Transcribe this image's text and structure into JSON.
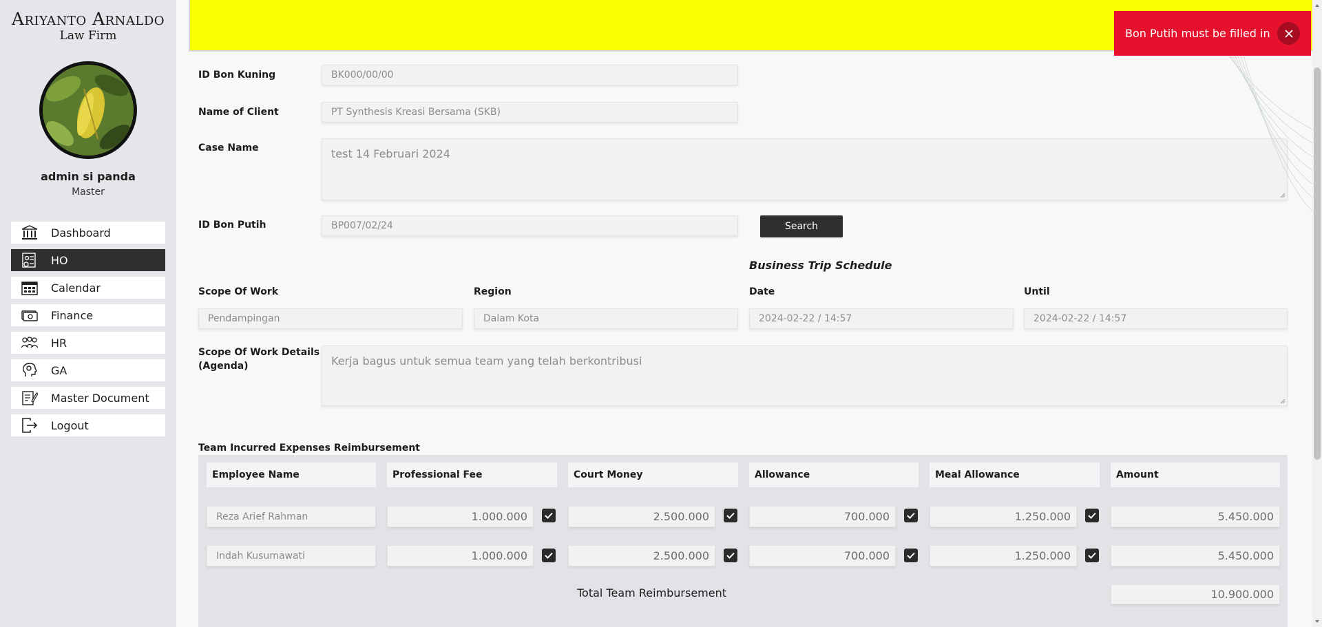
{
  "brand": {
    "line1": "Ariyanto Arnaldo",
    "line2": "Law Firm"
  },
  "user": {
    "name": "admin si panda",
    "role": "Master"
  },
  "nav": [
    {
      "label": "Dashboard",
      "icon": "bank-icon",
      "active": false
    },
    {
      "label": "HO",
      "icon": "document-id-icon",
      "active": true
    },
    {
      "label": "Calendar",
      "icon": "calendar-icon",
      "active": false
    },
    {
      "label": "Finance",
      "icon": "money-icon",
      "active": false
    },
    {
      "label": "HR",
      "icon": "people-icon",
      "active": false
    },
    {
      "label": "GA",
      "icon": "gear-head-icon",
      "active": false
    },
    {
      "label": "Master Document",
      "icon": "edit-document-icon",
      "active": false
    },
    {
      "label": "Logout",
      "icon": "logout-icon",
      "active": false
    }
  ],
  "form": {
    "id_bon_kuning": {
      "label": "ID Bon Kuning",
      "placeholder": "BK000/00/00"
    },
    "client": {
      "label": "Name of Client",
      "value": "PT Synthesis Kreasi Bersama (SKB)"
    },
    "case_name": {
      "label": "Case Name",
      "value": "test 14 Februari 2024"
    },
    "id_bon_putih": {
      "label": "ID Bon Putih",
      "value": "BP007/02/24"
    },
    "search_button": "Search",
    "schedule_title": "Business Trip Schedule",
    "scope": {
      "label": "Scope Of Work",
      "value": "Pendampingan"
    },
    "region": {
      "label": "Region",
      "value": "Dalam Kota"
    },
    "date": {
      "label": "Date",
      "value": "2024-02-22 / 14:57"
    },
    "until": {
      "label": "Until",
      "value": "2024-02-22 / 14:57"
    },
    "scope_details": {
      "label_line1": "Scope Of Work Details",
      "label_line2": "(Agenda)",
      "value": "Kerja bagus untuk semua team yang telah berkontribusi"
    }
  },
  "reimbursement": {
    "title": "Team Incurred Expenses Reimbursement",
    "columns": [
      "Employee Name",
      "Professional Fee",
      "Court Money",
      "Allowance",
      "Meal Allowance",
      "Amount"
    ],
    "rows": [
      {
        "name": "Reza Arief Rahman",
        "professional_fee": "1.000.000",
        "court_money": "2.500.000",
        "allowance": "700.000",
        "meal_allowance": "1.250.000",
        "amount": "5.450.000"
      },
      {
        "name": "Indah Kusumawati",
        "professional_fee": "1.000.000",
        "court_money": "2.500.000",
        "allowance": "700.000",
        "meal_allowance": "1.250.000",
        "amount": "5.450.000"
      }
    ],
    "total_label": "Total Team Reimbursement",
    "total_value": "10.900.000"
  },
  "toast": {
    "message": "Bon Putih must be filled in",
    "color": "#e8112d"
  },
  "colors": {
    "banner": "#fbff00",
    "sidebar": "#e4e6ea",
    "active_nav": "#2f2f2f"
  }
}
